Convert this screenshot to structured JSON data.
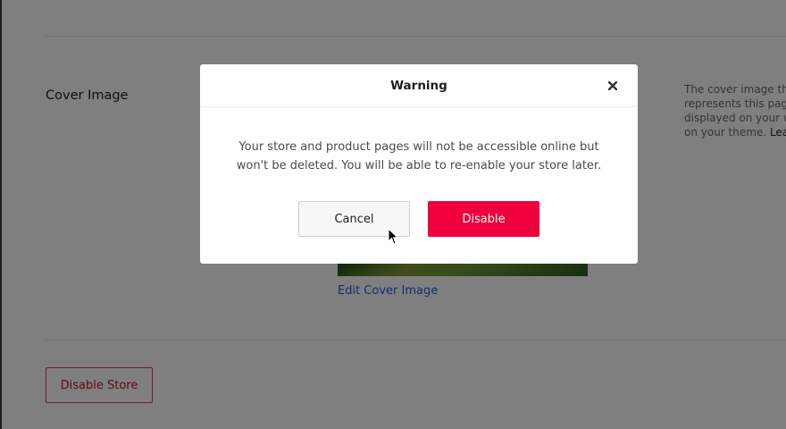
{
  "page": {
    "section_label": "Cover Image",
    "edit_cover_link": "Edit Cover Image",
    "help_text_lines": [
      "The cover image th",
      "represents this pag",
      "displayed on your w",
      "on your theme. "
    ],
    "help_learn_link": "Lea",
    "disable_store_button": "Disable Store"
  },
  "modal": {
    "title": "Warning",
    "close_icon": "close-icon",
    "message_line1": "Your store and product pages will not be accessible online but",
    "message_line2": "won't be deleted. You will be able to re-enable your store later.",
    "cancel_label": "Cancel",
    "disable_label": "Disable"
  },
  "colors": {
    "accent_red": "#f0003c",
    "outline_red": "#c8102e",
    "link_blue": "#2a5cd6"
  }
}
